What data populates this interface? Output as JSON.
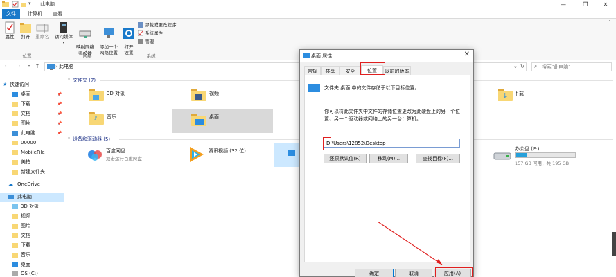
{
  "window": {
    "title": "此电脑",
    "controls": {
      "minimize": "—",
      "maximize": "❐",
      "close": "✕"
    }
  },
  "ribbon_tabs": [
    "文件",
    "计算机",
    "查看"
  ],
  "ribbon": {
    "buttons": {
      "properties": "属性",
      "open": "打开",
      "rename": "重命名",
      "access_media": "访问媒体",
      "map_drive": "映射网络\n驱动器",
      "add_location": "添加一个\n网络位置",
      "open_settings": "打开\n设置"
    },
    "small": {
      "uninstall": "卸载或更改程序",
      "system_props": "系统属性",
      "manage": "管理"
    },
    "groups": {
      "location": "位置",
      "network": "网络",
      "system": "系统"
    }
  },
  "address": {
    "path": "此电脑",
    "search_placeholder": "搜索\"此电脑\""
  },
  "nav": {
    "quick_access": "快速访问",
    "quick_items": [
      "桌面",
      "下载",
      "文档",
      "图片",
      "此电脑",
      "00000",
      "MobileFile",
      "美拍",
      "新建文件夹"
    ],
    "onedrive": "OneDrive",
    "this_pc": "此电脑",
    "pc_items": [
      "3D 对象",
      "视频",
      "图片",
      "文档",
      "下载",
      "音乐",
      "桌面",
      "OS (C:)"
    ]
  },
  "content": {
    "folders_header": "文件夹 (7)",
    "folders": [
      "3D 对象",
      "视频",
      "下载",
      "音乐",
      "桌面"
    ],
    "devices_header": "设备和驱动器 (5)",
    "devices": [
      {
        "name": "百度网盘",
        "sub": "双击运行百度网盘"
      },
      {
        "name": "腾讯视频 (32 位)",
        "sub": ""
      },
      {
        "name": "办公盘 (E:)",
        "sub": "157 GB 可用，共 195 GB"
      }
    ]
  },
  "dialog": {
    "title": "桌面 属性",
    "close": "✕",
    "tabs": [
      "常规",
      "共享",
      "安全",
      "位置",
      "以前的版本"
    ],
    "active_tab": "位置",
    "info_line": "文件夹 桌面 中的文件存储于以下目标位置。",
    "desc_line1": "你可以将此文件夹中文件的存储位置更改为此硬盘上的另一个位",
    "desc_line2": "置、另一个驱动器或网络上的另一台计算机。",
    "path_value": "D:\\Users\\12852\\Desktop",
    "buttons": {
      "restore": "还原默认值(R)",
      "move": "移动(M)...",
      "find": "查找目标(F)..."
    },
    "footer": {
      "ok": "确定",
      "cancel": "取消",
      "apply": "应用(A)"
    }
  },
  "colors": {
    "accent": "#1979ca",
    "selection": "#cce8ff",
    "folder": "#f8d775",
    "annotation": "#e02020"
  }
}
